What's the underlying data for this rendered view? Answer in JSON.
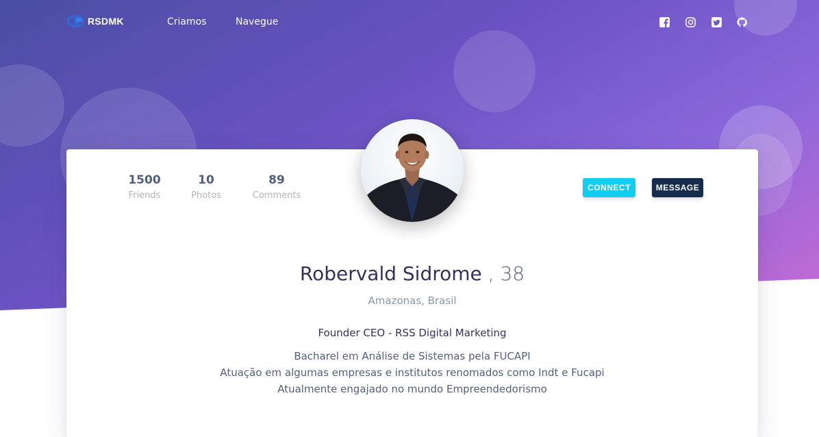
{
  "brand": {
    "name": "RSDMK",
    "logo_icon": "r-logo-icon"
  },
  "nav": {
    "links": [
      {
        "label": "Criamos"
      },
      {
        "label": "Navegue"
      }
    ]
  },
  "social": [
    {
      "icon": "facebook-icon"
    },
    {
      "icon": "instagram-icon"
    },
    {
      "icon": "twitter-icon"
    },
    {
      "icon": "github-icon"
    }
  ],
  "stats": [
    {
      "value": "1500",
      "label": "Friends"
    },
    {
      "value": "10",
      "label": "Photos"
    },
    {
      "value": "89",
      "label": "Comments"
    }
  ],
  "actions": {
    "connect_label": "CONNECT",
    "message_label": "MESSAGE"
  },
  "profile": {
    "name": "Robervald Sidrome",
    "age_text": ", 38",
    "location": "Amazonas, Brasil",
    "role": "Founder CEO - RSS Digital Marketing",
    "bio": [
      "Bacharel em Análise de Sistemas pela FUCAPI",
      "Atuação em algumas empresas e institutos renomados como Indt e Fucapi",
      "Atualmente engajado no mundo Empreendedorismo"
    ]
  },
  "colors": {
    "hero_start": "#4a4ea3",
    "hero_end": "#c86bd4",
    "connect": "#11cdef",
    "message": "#172b4d",
    "heading": "#32325d"
  }
}
